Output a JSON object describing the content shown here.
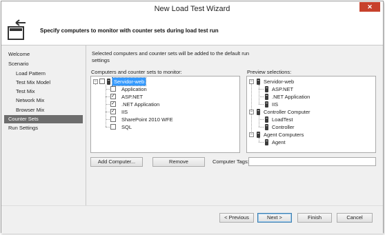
{
  "window": {
    "title": "New Load Test Wizard",
    "close_glyph": "✕"
  },
  "header": {
    "instruction": "Specify computers to monitor with counter sets during load test run"
  },
  "nav": {
    "items": [
      {
        "label": "Welcome",
        "sub": false,
        "selected": false
      },
      {
        "label": "Scenario",
        "sub": false,
        "selected": false
      },
      {
        "label": "Load Pattern",
        "sub": true,
        "selected": false
      },
      {
        "label": "Test Mix Model",
        "sub": true,
        "selected": false
      },
      {
        "label": "Test Mix",
        "sub": true,
        "selected": false
      },
      {
        "label": "Network Mix",
        "sub": true,
        "selected": false
      },
      {
        "label": "Browser Mix",
        "sub": true,
        "selected": false
      },
      {
        "label": "Counter Sets",
        "sub": false,
        "selected": true
      },
      {
        "label": "Run Settings",
        "sub": false,
        "selected": false
      }
    ]
  },
  "main": {
    "intro": "Selected computers and counter sets will be added to the default run settings",
    "computers_label": "Computers and counter sets to monitor:",
    "preview_label": "Preview selections:",
    "computers_tree": {
      "root": {
        "label": "Servidor-web",
        "checked": false
      },
      "children": [
        {
          "label": "Application",
          "checked": false
        },
        {
          "label": "ASP.NET",
          "checked": true
        },
        {
          "label": ".NET Application",
          "checked": true
        },
        {
          "label": "IIS",
          "checked": true
        },
        {
          "label": "SharePoint 2010 WFE",
          "checked": false
        },
        {
          "label": "SQL",
          "checked": false
        }
      ]
    },
    "preview_tree": [
      {
        "label": "Servidor-web",
        "children": [
          "ASP.NET",
          ".NET Application",
          "IIS"
        ]
      },
      {
        "label": "Controller Computer",
        "children": [
          "LoadTest",
          "Controller"
        ]
      },
      {
        "label": "Agent Computers",
        "children": [
          "Agent"
        ]
      }
    ],
    "add_computer_label": "Add Computer...",
    "remove_label": "Remove",
    "computer_tags_label": "Computer Tags:",
    "computer_tags_value": ""
  },
  "footer": {
    "previous_label": "< Previous",
    "next_label": "Next >",
    "finish_label": "Finish",
    "cancel_label": "Cancel"
  },
  "colors": {
    "selection": "#3399ff",
    "nav_selected": "#6d6d6d",
    "close_button": "#c7412c"
  }
}
